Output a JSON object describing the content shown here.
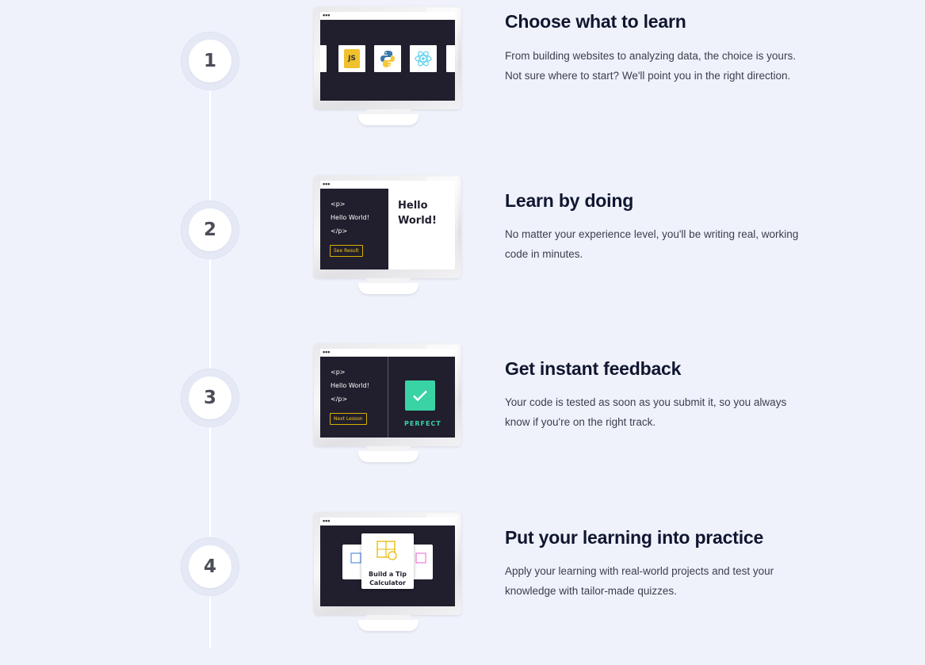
{
  "steps": [
    {
      "number": "1",
      "title": "Choose what to learn",
      "description": "From building websites to analyzing data, the choice is yours. Not sure where to start? We'll point you in the right direction.",
      "illustration": {
        "tiles": [
          "javascript-icon",
          "python-icon",
          "react-icon"
        ],
        "js_label": "JS"
      }
    },
    {
      "number": "2",
      "title": "Learn by doing",
      "description": "No matter your experience level, you'll be writing real, working code in minutes.",
      "illustration": {
        "code_lines": [
          "<p>",
          "Hello World!",
          "</p>"
        ],
        "button": "See Result",
        "result_line1": "Hello",
        "result_line2": "World!"
      }
    },
    {
      "number": "3",
      "title": "Get instant feedback",
      "description": "Your code is tested as soon as you submit it, so you always know if you're on the right track.",
      "illustration": {
        "code_lines": [
          "<p>",
          "Hello World!",
          "</p>"
        ],
        "button": "Next Lesson",
        "status": "PERFECT"
      }
    },
    {
      "number": "4",
      "title": "Put your learning into practice",
      "description": "Apply your learning with real-world projects and test your knowledge with tailor-made quizzes.",
      "illustration": {
        "project_line1": "Build a Tip",
        "project_line2": "Calculator"
      }
    }
  ],
  "colors": {
    "background": "#eff2fb",
    "screen": "#211e2d",
    "accent_yellow": "#f1c81f",
    "success_green": "#3ad3a5",
    "heading": "#10162f"
  }
}
